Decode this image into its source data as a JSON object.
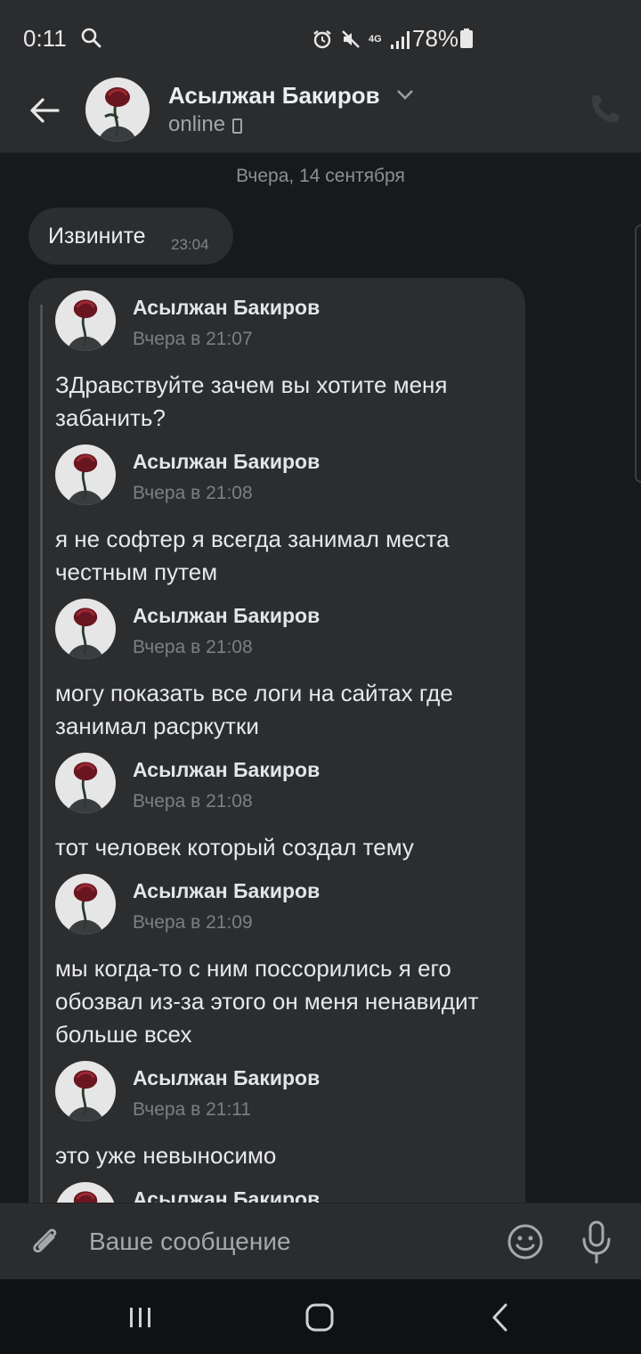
{
  "status_bar": {
    "time": "0:11",
    "network": "4G",
    "battery": "78%"
  },
  "header": {
    "contact_name": "Асылжан Бакиров",
    "status": "online"
  },
  "chat": {
    "date_separator": "Вчера, 14 сентября",
    "message": {
      "text": "Извините",
      "time": "23:04"
    },
    "forwarded": [
      {
        "author": "Асылжан Бакиров",
        "time": "Вчера в 21:07",
        "text": "ЗДравствуйте зачем вы хотите меня забанить?"
      },
      {
        "author": "Асылжан Бакиров",
        "time": "Вчера в 21:08",
        "text": "я не софтер я всегда занимал места честным путем"
      },
      {
        "author": "Асылжан Бакиров",
        "time": "Вчера в 21:08",
        "text": "могу показать все логи на сайтах где занимал расркутки"
      },
      {
        "author": "Асылжан Бакиров",
        "time": "Вчера в 21:08",
        "text": "тот человек который создал тему"
      },
      {
        "author": "Асылжан Бакиров",
        "time": "Вчера в 21:09",
        "text": "мы когда-то с ним поссорились я его обозвал из-за этого он меня ненавидит больше всех"
      },
      {
        "author": "Асылжан Бакиров",
        "time": "Вчера в 21:11",
        "text": "это уже невыносимо"
      },
      {
        "author": "Асылжан Бакиров",
        "time": "",
        "text": ""
      }
    ]
  },
  "composer": {
    "placeholder": "Ваше сообщение"
  },
  "icons": {
    "back": "arrow-left-icon",
    "call": "phone-icon",
    "attach": "paperclip-icon",
    "emoji": "smiley-icon",
    "mic": "microphone-icon"
  },
  "colors": {
    "background": "#18191b",
    "panel": "#2b2c2e",
    "bubble": "#2c2d2f",
    "secondary_text": "#a2a5a8"
  }
}
